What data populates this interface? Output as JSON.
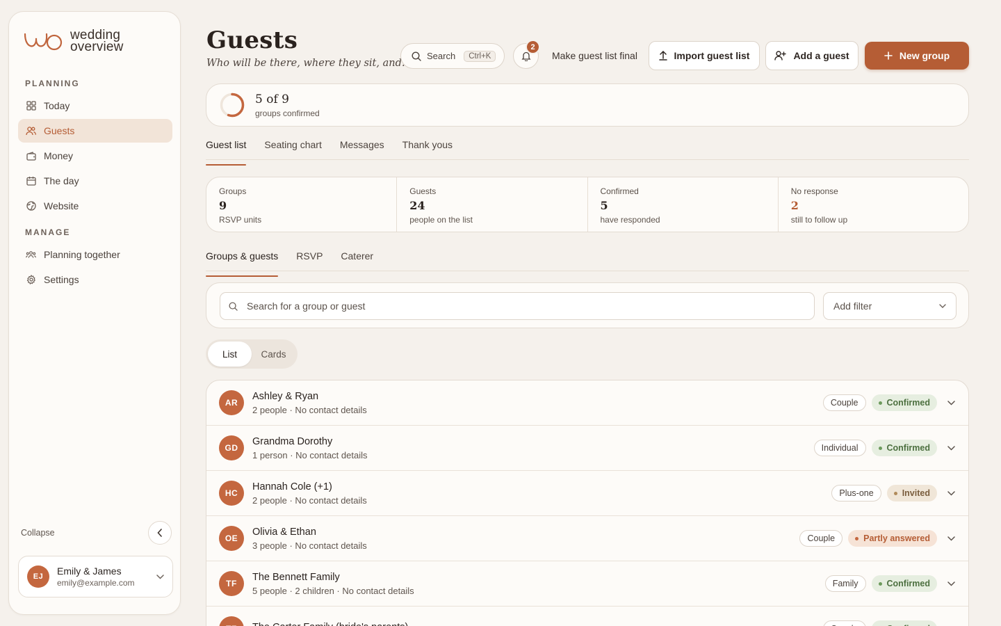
{
  "brand": {
    "line1": "wedding",
    "line2": "overview"
  },
  "sidebar": {
    "sections": [
      {
        "title": "PLANNING"
      },
      {
        "title": "MANAGE"
      }
    ],
    "planning_items": [
      {
        "label": "Today",
        "icon": "grid-icon"
      },
      {
        "label": "Guests",
        "icon": "people-icon",
        "active": true
      },
      {
        "label": "Money",
        "icon": "wallet-icon"
      },
      {
        "label": "The day",
        "icon": "calendar-icon"
      },
      {
        "label": "Website",
        "icon": "globe-icon"
      }
    ],
    "manage_items": [
      {
        "label": "Planning together",
        "icon": "team-icon"
      },
      {
        "label": "Settings",
        "icon": "gear-icon"
      }
    ],
    "collapse_label": "Collapse",
    "account": {
      "initials": "EJ",
      "name": "Emily & James",
      "email": "emily@example.com"
    }
  },
  "header": {
    "title": "Guests",
    "subtitle": "Who will be there, where they sit, and…",
    "search_label": "Search",
    "search_shortcut": "Ctrl+K",
    "notification_count": "2",
    "final_link": "Make guest list final",
    "import_label": "Import guest list",
    "add_guest_label": "Add a guest",
    "new_group_label": "New group"
  },
  "progress": {
    "main": "5 of 9",
    "sub": "groups confirmed",
    "fraction": 0.5556
  },
  "main_tabs": [
    "Guest list",
    "Seating chart",
    "Messages",
    "Thank yous"
  ],
  "stats": [
    {
      "label": "Groups",
      "value": "9",
      "sub": "RSVP units"
    },
    {
      "label": "Guests",
      "value": "24",
      "sub": "people on the list"
    },
    {
      "label": "Confirmed",
      "value": "5",
      "sub": "have responded"
    },
    {
      "label": "No response",
      "value": "2",
      "sub": "still to follow up"
    }
  ],
  "sub_tabs": [
    "Groups & guests",
    "RSVP",
    "Caterer"
  ],
  "search": {
    "placeholder": "Search for a group or guest",
    "filter_label": "Add filter"
  },
  "view_toggle": [
    "List",
    "Cards"
  ],
  "groups": [
    {
      "initials": "AR",
      "name": "Ashley & Ryan",
      "meta": "2 people · No contact details",
      "type": "Couple",
      "status": "Confirmed",
      "status_kind": "confirmed"
    },
    {
      "initials": "GD",
      "name": "Grandma Dorothy",
      "meta": "1 person · No contact details",
      "type": "Individual",
      "status": "Confirmed",
      "status_kind": "confirmed"
    },
    {
      "initials": "HC",
      "name": "Hannah Cole (+1)",
      "meta": "2 people · No contact details",
      "type": "Plus-one",
      "status": "Invited",
      "status_kind": "invited"
    },
    {
      "initials": "OE",
      "name": "Olivia & Ethan",
      "meta": "3 people · No contact details",
      "type": "Couple",
      "status": "Partly answered",
      "status_kind": "partly"
    },
    {
      "initials": "TF",
      "name": "The Bennett Family",
      "meta": "5 people · 2 children · No contact details",
      "type": "Family",
      "status": "Confirmed",
      "status_kind": "confirmed"
    },
    {
      "initials": "TF",
      "name": "The Carter Family (bride's parents)",
      "meta": "",
      "type": "Couple",
      "status": "Confirmed",
      "status_kind": "confirmed"
    }
  ],
  "colors": {
    "accent": "#b55d35",
    "background": "#f5f1ec",
    "confirmed": "#4d7040"
  }
}
